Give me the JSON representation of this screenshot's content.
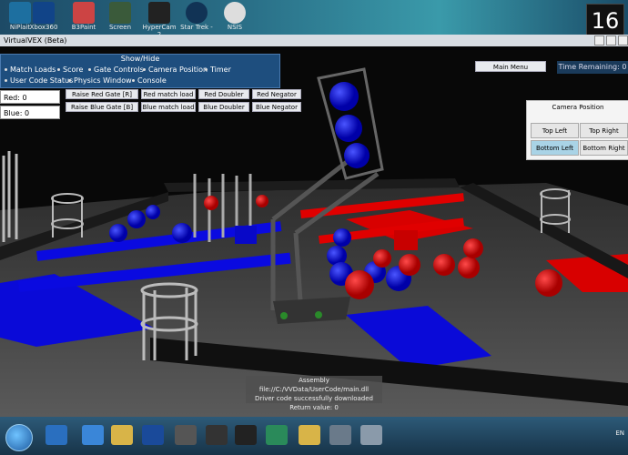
{
  "desktop": {
    "icons": [
      {
        "label": "NiPlait",
        "color": "#1d6fa0"
      },
      {
        "label": "Xbox360",
        "color": "#114488"
      },
      {
        "label": "B3Paint",
        "color": "#c44"
      },
      {
        "label": "Screen",
        "color": "#3a5a3a"
      },
      {
        "label": "HyperCam 2",
        "color": "#222"
      },
      {
        "label": "Star Trek -",
        "color": "#113355"
      },
      {
        "label": "NSIS",
        "color": "#ddd"
      }
    ],
    "clock": "16"
  },
  "window": {
    "title": "VirtualVEX (Beta)",
    "show_hide": {
      "title": "Show/Hide",
      "options": [
        "Match Loads",
        "Score",
        "Gate Controls",
        "Camera Position",
        "Timer",
        "User Code Status",
        "Physics Window",
        "Console"
      ]
    },
    "scores": {
      "red": "Red: 0",
      "blue": "Blue: 0"
    },
    "controls": [
      "Raise Red Gate [R]",
      "Red match load",
      "Red Doubler",
      "Red Negator",
      "Raise Blue Gate [B]",
      "Blue match load",
      "Blue Doubler",
      "Blue Negator"
    ],
    "main_menu": "Main Menu",
    "timer": "Time Remaining: 0",
    "camera": {
      "title": "Camera Position",
      "buttons": [
        "Top Left",
        "Top Right",
        "Bottom Left",
        "Bottom Right"
      ],
      "active": "Bottom Left"
    },
    "console": [
      "Assembly file://C:/VVData/UserCode/main.dll",
      "Driver code successfully downloaded",
      "Return value: 0"
    ]
  },
  "taskbar": {
    "lang": "EN"
  }
}
